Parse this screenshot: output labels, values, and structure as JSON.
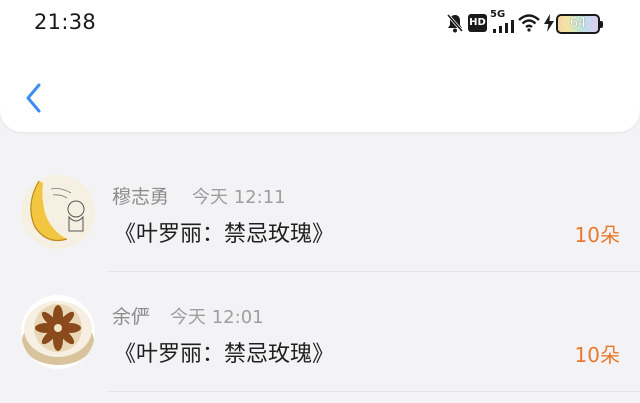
{
  "status_bar": {
    "time": "21:38",
    "hd_label": "HD",
    "network_label": "5G",
    "battery_level": "64",
    "icons": [
      "mute-icon",
      "hd-icon",
      "5g-signal-icon",
      "wifi-icon",
      "charging-bolt-icon",
      "battery-icon"
    ]
  },
  "nav": {
    "back_icon": "chevron-left-icon",
    "accent_color": "#3d8ef0"
  },
  "list": {
    "items": [
      {
        "name": "穆志勇",
        "time": "今天 12:11",
        "gift": "《叶罗丽：禁忌玫瑰》",
        "count": "10朵"
      },
      {
        "name": "余俨",
        "time": "今天 12:01",
        "gift": "《叶罗丽：禁忌玫瑰》",
        "count": "10朵"
      }
    ]
  },
  "colors": {
    "count": "#e8792f",
    "name": "#8c8c8c",
    "title": "#1f1f1f"
  }
}
